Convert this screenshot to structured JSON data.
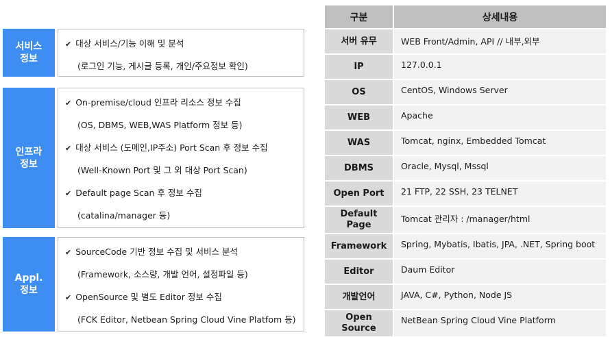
{
  "left_sections": [
    {
      "label_lines": [
        "서비스",
        "정보"
      ],
      "lines": [
        {
          "type": "bullet",
          "text": "대상 서비스/기능 이해 및 분석"
        },
        {
          "type": "sub",
          "text": "(로그인 기능, 게시글 등록, 개인/주요정보 확인)"
        }
      ]
    },
    {
      "label_lines": [
        "인프라",
        "정보"
      ],
      "lines": [
        {
          "type": "bullet",
          "text": "On-premise/cloud 인프라 리소스 정보 수집"
        },
        {
          "type": "sub",
          "text": "(OS, DBMS, WEB,WAS Platform 정보 등)"
        },
        {
          "type": "bullet",
          "text": "대상 서비스 (도메인,IP주소) Port Scan 후 정보 수집"
        },
        {
          "type": "sub",
          "text": "(Well-Known Port 및 그 외 대상 Port Scan)"
        },
        {
          "type": "bullet",
          "text": "Default page Scan 후 정보 수집"
        },
        {
          "type": "sub",
          "text": "(catalina/manager 등)"
        }
      ]
    },
    {
      "label_lines": [
        "Appl.",
        "정보"
      ],
      "lines": [
        {
          "type": "bullet",
          "text": "SourceCode 기반 정보 수집 및 서비스 분석"
        },
        {
          "type": "sub",
          "text": "(Framework, 소스량, 개발 언어, 설정파일 등)"
        },
        {
          "type": "bullet",
          "text": "OpenSource 및 별도 Editor 정보 수집"
        },
        {
          "type": "sub",
          "text": "(FCK Editor, Netbean Spring Cloud Vine Platfom 등)"
        }
      ]
    }
  ],
  "table": {
    "headers": [
      "구분",
      "상세내용"
    ],
    "rows": [
      {
        "key_lines": [
          "서버 유무"
        ],
        "value": "WEB Front/Admin, API // 내부,외부"
      },
      {
        "key_lines": [
          "IP"
        ],
        "value": "127.0.0.1"
      },
      {
        "key_lines": [
          "OS"
        ],
        "value": "CentOS, Windows Server"
      },
      {
        "key_lines": [
          "WEB"
        ],
        "value": "Apache"
      },
      {
        "key_lines": [
          "WAS"
        ],
        "value": "Tomcat, nginx, Embedded Tomcat"
      },
      {
        "key_lines": [
          "DBMS"
        ],
        "value": "Oracle, Mysql, Mssql"
      },
      {
        "key_lines": [
          "Open Port"
        ],
        "value": "21  FTP, 22 SSH, 23 TELNET"
      },
      {
        "key_lines": [
          "Default",
          "Page"
        ],
        "value": "Tomcat 관리자 : /manager/html"
      },
      {
        "key_lines": [
          "Framework"
        ],
        "value": "Spring, Mybatis, Ibatis, JPA, .NET, Spring boot"
      },
      {
        "key_lines": [
          "Editor"
        ],
        "value": "Daum Editor"
      },
      {
        "key_lines": [
          "개발언어"
        ],
        "value": "JAVA, C#, Python, Node JS"
      },
      {
        "key_lines": [
          "Open",
          "Source"
        ],
        "value": "NetBean Spring Cloud Vine Platform"
      }
    ]
  },
  "colors": {
    "label_bg": "#3d8ef0",
    "header_bg": "#bfbfbf",
    "key_bg": "#d9d9d9",
    "value_bg": "#f2f2f2"
  }
}
